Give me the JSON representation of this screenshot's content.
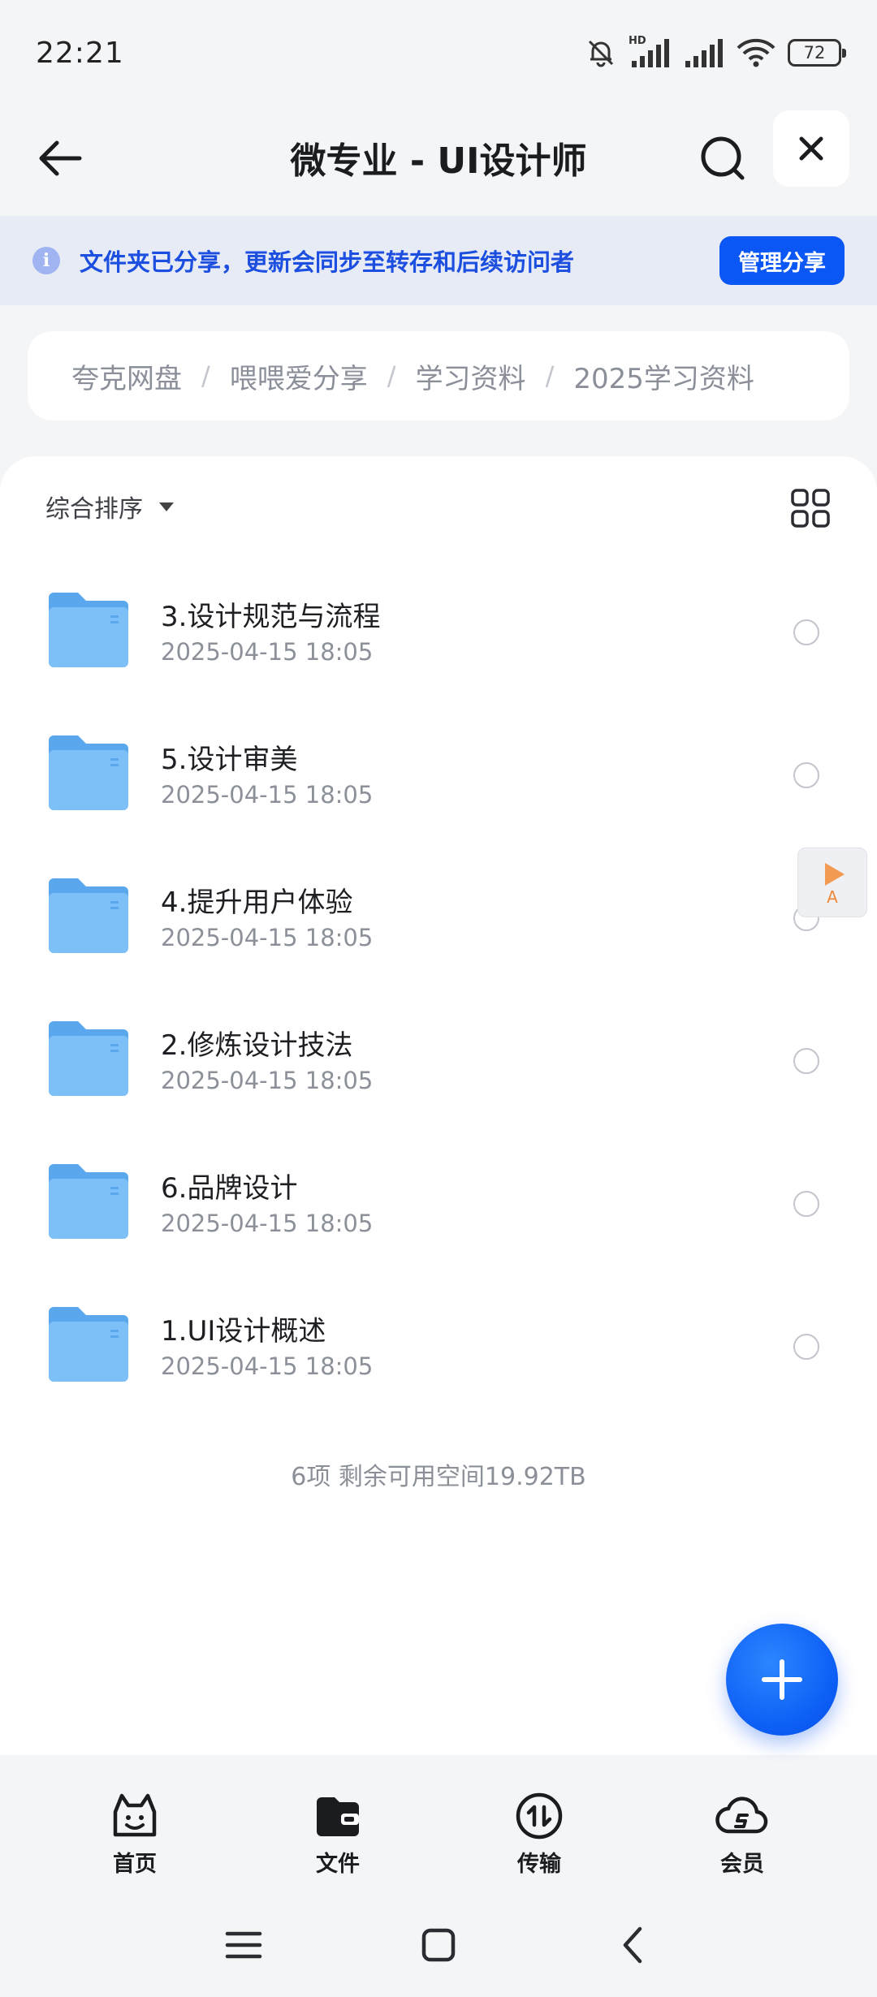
{
  "status_bar": {
    "time": "22:21",
    "battery": "72",
    "network_label": "HD"
  },
  "nav": {
    "title": "微专业 - UI设计师"
  },
  "share_banner": {
    "text": "文件夹已分享，更新会同步至转存和后续访问者",
    "button": "管理分享",
    "info_glyph": "i"
  },
  "breadcrumb": [
    "夸克网盘",
    "喂喂爱分享",
    "学习资料",
    "2025学习资料"
  ],
  "breadcrumb_separator": "/",
  "sort": {
    "label": "综合排序"
  },
  "files": [
    {
      "name": "3.设计规范与流程",
      "date": "2025-04-15 18:05"
    },
    {
      "name": "5.设计审美",
      "date": "2025-04-15 18:05"
    },
    {
      "name": "4.提升用户体验",
      "date": "2025-04-15 18:05"
    },
    {
      "name": "2.修炼设计技法",
      "date": "2025-04-15 18:05"
    },
    {
      "name": "6.品牌设计",
      "date": "2025-04-15 18:05"
    },
    {
      "name": "1.UI设计概述",
      "date": "2025-04-15 18:05"
    }
  ],
  "summary": "6项 剩余可用空间19.92TB",
  "float_tool": {
    "letter": "A"
  },
  "tabs": [
    {
      "label": "首页",
      "icon": "smile-face-icon"
    },
    {
      "label": "文件",
      "icon": "folder-wallet-icon"
    },
    {
      "label": "传输",
      "icon": "transfer-arrows-icon"
    },
    {
      "label": "会员",
      "icon": "cloud-vip-icon"
    }
  ],
  "colors": {
    "accent": "#0a57f5",
    "banner_bg": "#e6ebf6",
    "folder": "#5aaef3",
    "page_bg": "#f4f5f7"
  }
}
